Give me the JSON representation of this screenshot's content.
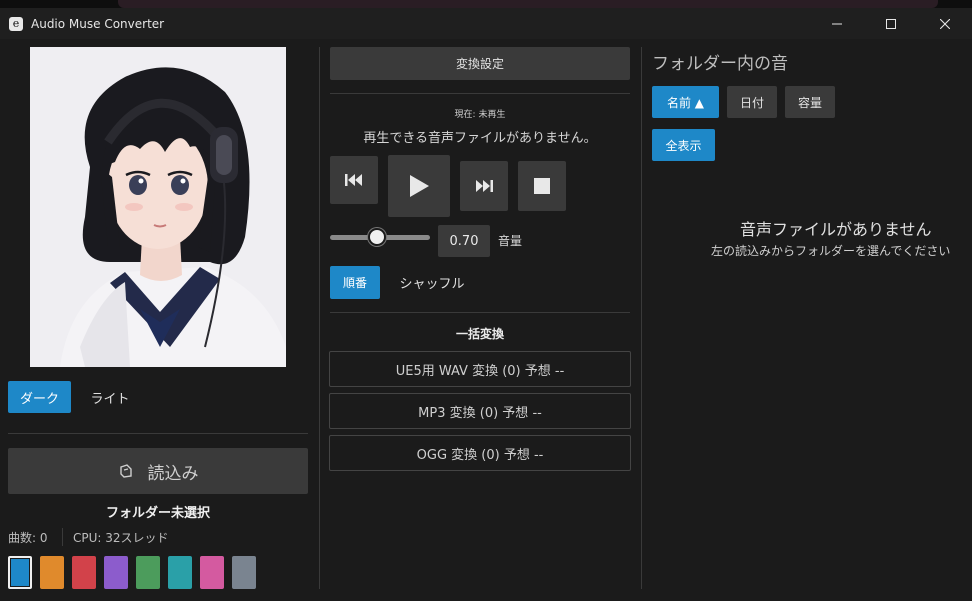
{
  "window": {
    "title": "Audio Muse Converter",
    "app_icon_glyph": "e"
  },
  "left": {
    "theme_dark": "ダーク",
    "theme_light": "ライト",
    "load_button": "読込み",
    "folder_status": "フォルダー未選択",
    "track_count": "曲数: 0",
    "cpu_info": "CPU: 32スレッド",
    "accent_colors": [
      "#1e88c8",
      "#e08a2c",
      "#d2424a",
      "#8c5ccc",
      "#4c9c5c",
      "#2aa0a8",
      "#d45aa0",
      "#7a8490"
    ]
  },
  "middle": {
    "settings_button": "変換設定",
    "now_playing": "現在: 未再生",
    "no_files_message": "再生できる音声ファイルがありません。",
    "volume_value": "0.70",
    "volume_label": "音量",
    "order_button": "順番",
    "shuffle_button": "シャッフル",
    "batch_title": "一括変換",
    "convert_wav": "UE5用 WAV 変換 (0)  予想 --",
    "convert_mp3": "MP3 変換 (0)  予想 --",
    "convert_ogg": "OGG 変換 (0)  予想 --"
  },
  "right": {
    "title": "フォルダー内の音",
    "sort_name": "名前 ▲",
    "sort_date": "日付",
    "sort_size": "容量",
    "show_all": "全表示",
    "empty_title": "音声ファイルがありません",
    "empty_hint": "左の読込みからフォルダーを選んでください"
  },
  "colors": {
    "accent": "#1e88c8",
    "background": "#1b1b1b",
    "button_gray": "#3a3a3a"
  }
}
